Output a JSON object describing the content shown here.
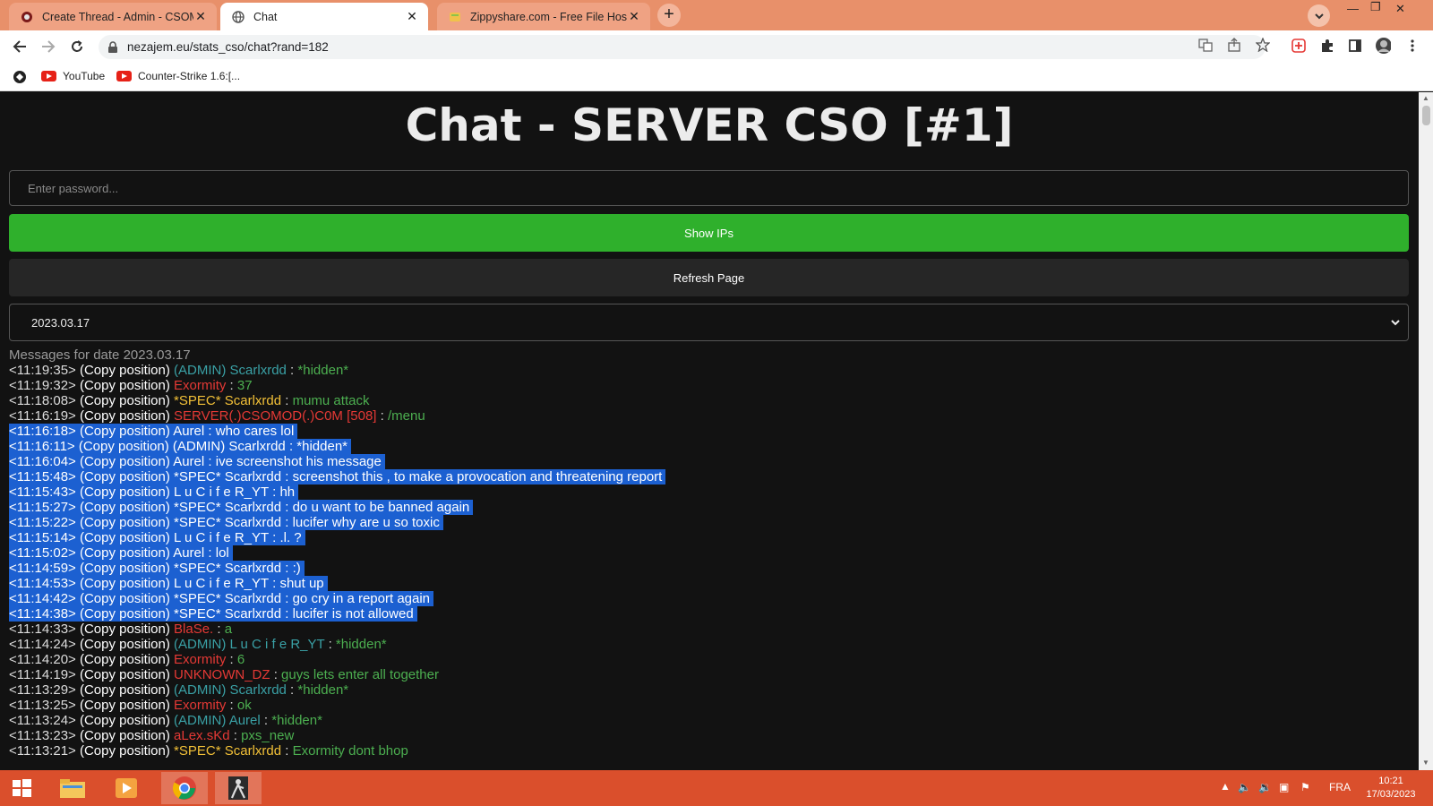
{
  "browser": {
    "tabs": [
      {
        "title": "Create Thread - Admin - CSOMO",
        "active": false
      },
      {
        "title": "Chat",
        "active": true
      },
      {
        "title": "Zippyshare.com - Free File Hostin",
        "active": false
      }
    ],
    "url": "nezajem.eu/stats_cso/chat?rand=182",
    "bookmarks": [
      "YouTube",
      "Counter-Strike 1.6:[..."
    ]
  },
  "page": {
    "heading": "Chat - SERVER CSO [#1]",
    "password_placeholder": "Enter password...",
    "show_ips_label": "Show IPs",
    "refresh_label": "Refresh Page",
    "selected_date": "2023.03.17",
    "messages_header": "Messages for date 2023.03.17",
    "copy_label": "(Copy position)",
    "messages": [
      {
        "time": "<11:19:35>",
        "name": "(ADMIN) Scarlxrdd",
        "name_color": "#3aa1a6",
        "text": "*hidden*",
        "text_color": "#4caf50",
        "selected": false
      },
      {
        "time": "<11:19:32>",
        "name": "Exormity",
        "name_color": "#e53935",
        "text": "37",
        "text_color": "#4caf50",
        "selected": false
      },
      {
        "time": "<11:18:08>",
        "name": "*SPEC* Scarlxrdd",
        "name_color": "#f2c037",
        "text": "mumu attack",
        "text_color": "#4caf50",
        "selected": false
      },
      {
        "time": "<11:16:19>",
        "name": "SERVER(.)CSOMOD(.)C0M [508]",
        "name_color": "#e53935",
        "text": "/menu",
        "text_color": "#4caf50",
        "selected": false
      },
      {
        "time": "<11:16:18>",
        "name": "Aurel",
        "name_color": "#ffffff",
        "text": "who cares lol",
        "text_color": "#ffffff",
        "selected": true
      },
      {
        "time": "<11:16:11>",
        "name": "(ADMIN) Scarlxrdd",
        "name_color": "#ffffff",
        "text": "*hidden*",
        "text_color": "#ffffff",
        "selected": true
      },
      {
        "time": "<11:16:04>",
        "name": "Aurel",
        "name_color": "#ffffff",
        "text": "ive screenshot his message",
        "text_color": "#ffffff",
        "selected": true
      },
      {
        "time": "<11:15:48>",
        "name": "*SPEC* Scarlxrdd",
        "name_color": "#ffffff",
        "text": "screenshot this , to make a provocation and threatening report",
        "text_color": "#ffffff",
        "selected": true
      },
      {
        "time": "<11:15:43>",
        "name": "L u C i f e R_YT",
        "name_color": "#ffffff",
        "text": "hh",
        "text_color": "#ffffff",
        "selected": true
      },
      {
        "time": "<11:15:27>",
        "name": "*SPEC* Scarlxrdd",
        "name_color": "#ffffff",
        "text": "do u want to be banned again",
        "text_color": "#ffffff",
        "selected": true
      },
      {
        "time": "<11:15:22>",
        "name": "*SPEC* Scarlxrdd",
        "name_color": "#ffffff",
        "text": "lucifer why are u so toxic",
        "text_color": "#ffffff",
        "selected": true
      },
      {
        "time": "<11:15:14>",
        "name": "L u C i f e R_YT",
        "name_color": "#ffffff",
        "text": ".l. ?",
        "text_color": "#ffffff",
        "selected": true
      },
      {
        "time": "<11:15:02>",
        "name": "Aurel",
        "name_color": "#ffffff",
        "text": "lol",
        "text_color": "#ffffff",
        "selected": true
      },
      {
        "time": "<11:14:59>",
        "name": "*SPEC* Scarlxrdd",
        "name_color": "#ffffff",
        "text": ":)",
        "text_color": "#ffffff",
        "selected": true
      },
      {
        "time": "<11:14:53>",
        "name": "L u C i f e R_YT",
        "name_color": "#ffffff",
        "text": "shut up",
        "text_color": "#ffffff",
        "selected": true
      },
      {
        "time": "<11:14:42>",
        "name": "*SPEC* Scarlxrdd",
        "name_color": "#ffffff",
        "text": "go cry in a report again",
        "text_color": "#ffffff",
        "selected": true
      },
      {
        "time": "<11:14:38>",
        "name": "*SPEC* Scarlxrdd",
        "name_color": "#ffffff",
        "text": "lucifer is not allowed",
        "text_color": "#ffffff",
        "selected": true
      },
      {
        "time": "<11:14:33>",
        "name": "BlaSe.",
        "name_color": "#e53935",
        "text": "a",
        "text_color": "#4caf50",
        "selected": false
      },
      {
        "time": "<11:14:24>",
        "name": "(ADMIN) L u C i f e R_YT",
        "name_color": "#3aa1a6",
        "text": "*hidden*",
        "text_color": "#4caf50",
        "selected": false
      },
      {
        "time": "<11:14:20>",
        "name": "Exormity",
        "name_color": "#e53935",
        "text": "6",
        "text_color": "#4caf50",
        "selected": false
      },
      {
        "time": "<11:14:19>",
        "name": "UNKNOWN_DZ",
        "name_color": "#e53935",
        "text": "guys lets enter all together",
        "text_color": "#4caf50",
        "selected": false
      },
      {
        "time": "<11:13:29>",
        "name": "(ADMIN) Scarlxrdd",
        "name_color": "#3aa1a6",
        "text": "*hidden*",
        "text_color": "#4caf50",
        "selected": false
      },
      {
        "time": "<11:13:25>",
        "name": "Exormity",
        "name_color": "#e53935",
        "text": "ok",
        "text_color": "#4caf50",
        "selected": false
      },
      {
        "time": "<11:13:24>",
        "name": "(ADMIN) Aurel",
        "name_color": "#3aa1a6",
        "text": "*hidden*",
        "text_color": "#4caf50",
        "selected": false
      },
      {
        "time": "<11:13:23>",
        "name": "aLex.sKd",
        "name_color": "#e53935",
        "text": "pxs_new",
        "text_color": "#4caf50",
        "selected": false
      },
      {
        "time": "<11:13:21>",
        "name": "*SPEC* Scarlxrdd",
        "name_color": "#f2c037",
        "text": "Exormity dont bhop",
        "text_color": "#4caf50",
        "selected": false
      }
    ]
  },
  "taskbar": {
    "language": "FRA",
    "time": "10:21",
    "date": "17/03/2023"
  },
  "colors": {
    "tab_strip": "#e8906a",
    "taskbar": "#da4f2c",
    "show_ips_button": "#2fb02c",
    "selection": "#1c60d1"
  }
}
